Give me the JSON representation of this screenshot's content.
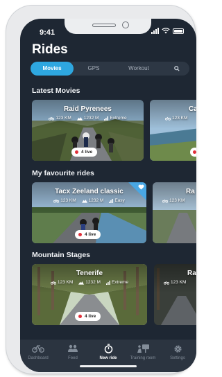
{
  "status_bar": {
    "time": "9:41"
  },
  "header": {
    "title": "Rides"
  },
  "tabs": [
    {
      "label": "Movies",
      "active": true
    },
    {
      "label": "GPS",
      "active": false
    },
    {
      "label": "Workout",
      "active": false
    },
    {
      "label": "",
      "icon": "search-icon",
      "active": false
    }
  ],
  "sections": [
    {
      "title": "Latest Movies",
      "cards": [
        {
          "title": "Raid Pyrenees",
          "distance": "123 KM",
          "elevation": "1232 M",
          "difficulty": "Extreme",
          "live": "4 live"
        },
        {
          "title": "Ca",
          "distance": "123 KM"
        }
      ]
    },
    {
      "title": "My favourite rides",
      "cards": [
        {
          "title": "Tacx Zeeland classic",
          "distance": "123 KM",
          "elevation": "1232 M",
          "difficulty": "Easy",
          "live": "4 live",
          "favourite": true,
          "favourite_icon": "heart-icon"
        },
        {
          "title": "Ra",
          "distance": "123 KM"
        }
      ]
    },
    {
      "title": "Mountain Stages",
      "cards": [
        {
          "title": "Tenerife",
          "distance": "123 KM",
          "elevation": "1232 M",
          "difficulty": "Extreme",
          "live": "4 live"
        },
        {
          "title": "Ra",
          "distance": "123 KM"
        }
      ]
    }
  ],
  "bottom_nav": [
    {
      "label": "Dashboard",
      "icon": "bike-icon",
      "active": false
    },
    {
      "label": "Feed",
      "icon": "people-icon",
      "active": false
    },
    {
      "label": "New ride",
      "icon": "stopwatch-icon",
      "active": true
    },
    {
      "label": "Training room",
      "icon": "training-room-icon",
      "active": false
    },
    {
      "label": "Settings",
      "icon": "gear-icon",
      "active": false
    }
  ],
  "colors": {
    "background": "#1e2733",
    "accent": "#2ea7e0",
    "live_dot": "#e0303a",
    "favourite": "#49a7e4"
  }
}
